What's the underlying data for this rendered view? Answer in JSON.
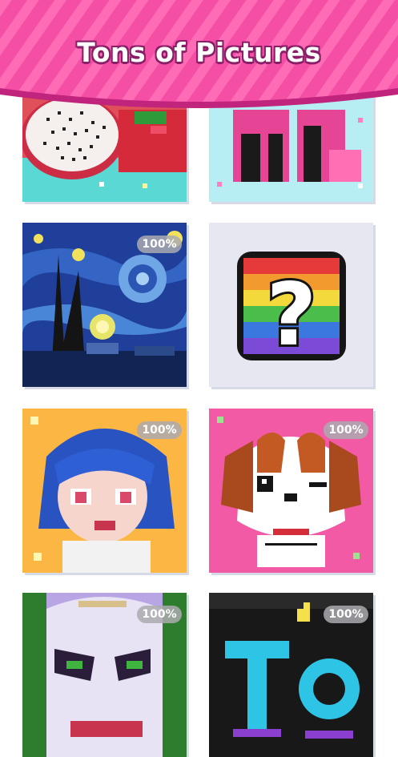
{
  "banner": {
    "title": "Tons of Pictures",
    "colors": {
      "pink": "#f44fa5",
      "stripe": "#ff73bc",
      "edge": "#c0247c"
    }
  },
  "gallery": {
    "items": [
      {
        "subject": "dragon-fruit",
        "progress_label": ""
      },
      {
        "subject": "pink-legs",
        "progress_label": ""
      },
      {
        "subject": "starry-night",
        "progress_label": "100%"
      },
      {
        "subject": "mystery",
        "progress_label": ""
      },
      {
        "subject": "anime-girl",
        "progress_label": "100%"
      },
      {
        "subject": "puppy",
        "progress_label": "100%"
      },
      {
        "subject": "joker",
        "progress_label": "100%"
      },
      {
        "subject": "letters-to",
        "progress_label": "100%"
      }
    ]
  },
  "mystery_icon": {
    "glyph": "?"
  }
}
